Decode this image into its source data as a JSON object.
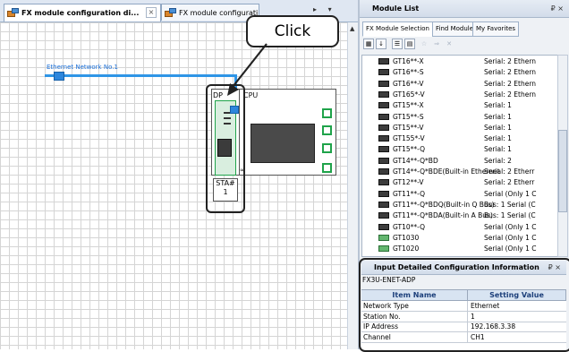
{
  "tabs": [
    {
      "label": "FX module configuration di...",
      "active": true
    },
    {
      "label": "FX module configurati",
      "active": false
    }
  ],
  "canvas": {
    "network_label": "Ethernet Network No.1",
    "adapter_label": "DP",
    "cpu_label": "CPU",
    "station_label": "STA#",
    "station_no": "1",
    "callout": "Click"
  },
  "module_list": {
    "title": "Module List",
    "tabs": [
      "FX Module Selection",
      "Find Module",
      "My Favorites"
    ],
    "items": [
      {
        "name": "GT16**-X",
        "spec": "Serial: 2 Ethern",
        "icon": "dark"
      },
      {
        "name": "GT16**-S",
        "spec": "Serial: 2 Ethern",
        "icon": "dark"
      },
      {
        "name": "GT16**-V",
        "spec": "Serial: 2 Ethern",
        "icon": "dark"
      },
      {
        "name": "GT165*-V",
        "spec": "Serial: 2 Ethern",
        "icon": "dark"
      },
      {
        "name": "GT15**-X",
        "spec": "Serial: 1",
        "icon": "dark"
      },
      {
        "name": "GT15**-S",
        "spec": "Serial: 1",
        "icon": "dark"
      },
      {
        "name": "GT15**-V",
        "spec": "Serial: 1",
        "icon": "dark"
      },
      {
        "name": "GT155*-V",
        "spec": "Serial: 1",
        "icon": "dark"
      },
      {
        "name": "GT15**-Q",
        "spec": "Serial: 1",
        "icon": "dark"
      },
      {
        "name": "GT14**-Q*BD",
        "spec": "Serial: 2",
        "icon": "dark"
      },
      {
        "name": "GT14**-Q*BDE(Built-in Ethernet",
        "spec": "Serial: 2 Etherr",
        "icon": "dark"
      },
      {
        "name": "GT12**-V",
        "spec": "Serial: 2 Etherr",
        "icon": "dark"
      },
      {
        "name": "GT11**-Q",
        "spec": "Serial (Only 1 C",
        "icon": "dark"
      },
      {
        "name": "GT11**-Q*BDQ(Built-in Q Bus)",
        "spec": "Bus: 1 Serial (C",
        "icon": "dark"
      },
      {
        "name": "GT11**-Q*BDA(Built-in A Bus)",
        "spec": "Bus: 1 Serial (C",
        "icon": "dark"
      },
      {
        "name": "GT10**-Q",
        "spec": "Serial (Only 1 C",
        "icon": "dark"
      },
      {
        "name": "GT1030",
        "spec": "Serial (Only 1 C",
        "icon": "green"
      },
      {
        "name": "GT1020",
        "spec": "Serial (Only 1 C",
        "icon": "green"
      }
    ]
  },
  "details": {
    "title": "Input Detailed Configuration Information",
    "model": "FX3U-ENET-ADP",
    "col_item": "Item Name",
    "col_value": "Setting Value",
    "rows": [
      {
        "k": "Network Type",
        "v": "Ethernet"
      },
      {
        "k": "Station No.",
        "v": "1"
      },
      {
        "k": "IP Address",
        "v": "192.168.3.38"
      },
      {
        "k": "Channel",
        "v": "CH1"
      }
    ]
  },
  "colors": {
    "network": "#2f95e6",
    "accent_green": "#1fa34a"
  }
}
